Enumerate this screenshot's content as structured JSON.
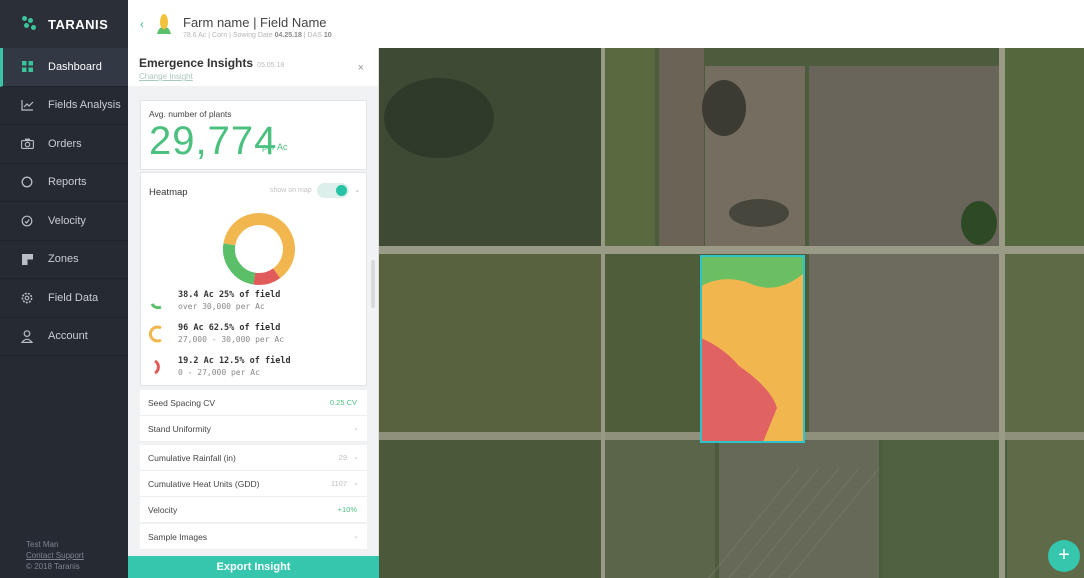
{
  "app": {
    "brand": "TARANIS"
  },
  "sidebar": {
    "items": [
      {
        "label": "Dashboard",
        "icon": "grid-icon",
        "active": true
      },
      {
        "label": "Fields Analysis",
        "icon": "line-chart-icon"
      },
      {
        "label": "Orders",
        "icon": "camera-icon"
      },
      {
        "label": "Reports",
        "icon": "circle-icon"
      },
      {
        "label": "Velocity",
        "icon": "gauge-icon"
      },
      {
        "label": "Zones",
        "icon": "zones-icon"
      },
      {
        "label": "Field Data",
        "icon": "gear-icon"
      },
      {
        "label": "Account",
        "icon": "user-icon"
      }
    ],
    "footer": {
      "user": "Test Man",
      "support": "Contact Support",
      "copyright": "© 2018 Taranis"
    }
  },
  "header": {
    "title": "Farm name | Field Name",
    "sub_prefix": "78.6 Ac | Corn | Sowing Date",
    "sowing_date": "04.25.18",
    "sub_sep": " | DAS",
    "das": "10"
  },
  "panel": {
    "title": "Emergence Insights",
    "date": "05.05.18",
    "change": "Change Insight",
    "close": "×",
    "avg": {
      "label": "Avg. number of plants",
      "value": "29,774",
      "unit": "per Ac"
    },
    "heatmap": {
      "label": "Heatmap",
      "show_on_map": "show on map",
      "toggle_on": true,
      "segments": [
        {
          "main": "38.4 Ac 25% of field",
          "sub": "over 30,000 per Ac",
          "color": "#5bbf6a",
          "share": 25
        },
        {
          "main": "96 Ac 62.5% of field",
          "sub": "27,000 - 30,000 per Ac",
          "color": "#f2b64f",
          "share": 62.5
        },
        {
          "main": "19.2 Ac 12.5% of field",
          "sub": "0 - 27,000 per Ac",
          "color": "#e25b5b",
          "share": 12.5
        }
      ]
    },
    "rows": [
      {
        "label": "Seed Spacing CV",
        "value": "0.25 CV"
      },
      {
        "label": "Stand Uniformity",
        "value": ""
      },
      {
        "label": "Cumulative Rainfall (in)",
        "value": "29"
      },
      {
        "label": "Cumulative Heat Units (GDD)",
        "value": "1107"
      },
      {
        "label": "Velocity",
        "value": "+10%"
      },
      {
        "label": "Sample Images",
        "value": ""
      }
    ],
    "export": "Export Insight"
  },
  "map": {
    "fab": "+"
  }
}
